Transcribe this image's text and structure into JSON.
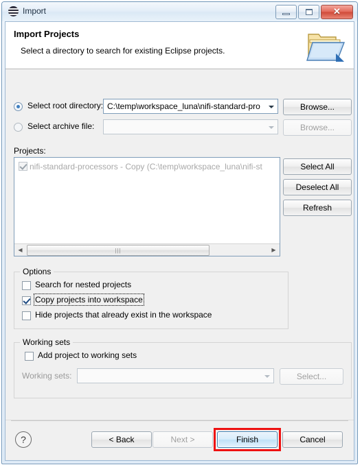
{
  "window": {
    "title": "Import",
    "icon": "eclipse-icon",
    "controls": {
      "minimize": "minimize-button",
      "maximize": "maximize-button",
      "close": "close-button",
      "close_glyph": "✕"
    }
  },
  "banner": {
    "title": "Import Projects",
    "subtitle": "Select a directory to search for existing Eclipse projects.",
    "icon": "import-folder-icon"
  },
  "source": {
    "root_directory": {
      "label": "Select root directory:",
      "mnemonic": "o",
      "selected": true,
      "value": "C:\\temp\\workspace_luna\\nifi-standard-pro",
      "browse_label": "Browse...",
      "browse_enabled": true
    },
    "archive_file": {
      "label": "Select archive file:",
      "mnemonic": "a",
      "selected": false,
      "value": "",
      "placeholder": "",
      "browse_label": "Browse...",
      "browse_enabled": false
    }
  },
  "projects": {
    "label": "Projects:",
    "items": [
      {
        "label": "nifi-standard-processors - Copy (C:\\temp\\workspace_luna\\nifi-st",
        "checked": true,
        "enabled": false
      }
    ],
    "buttons": {
      "select_all": "Select All",
      "deselect_all": "Deselect All",
      "refresh": "Refresh"
    },
    "scrollbar": {
      "left_arrow": "◀",
      "right_arrow": "▶",
      "thumb_grip": "|||"
    }
  },
  "options": {
    "title": "Options",
    "items": [
      {
        "label": "Search for nested projects",
        "checked": false,
        "focused": false
      },
      {
        "label": "Copy projects into workspace",
        "checked": true,
        "focused": true
      },
      {
        "label": "Hide projects that already exist in the workspace",
        "checked": false,
        "focused": false
      }
    ]
  },
  "working_sets": {
    "title": "Working sets",
    "add_checkbox": {
      "label": "Add project to working sets",
      "checked": false
    },
    "field_label": "Working sets:",
    "field_value": "",
    "field_enabled": false,
    "select_button": {
      "label": "Select...",
      "enabled": false
    }
  },
  "footer": {
    "help": "?",
    "back": {
      "label": "< Back",
      "enabled": true
    },
    "next": {
      "label": "Next >",
      "enabled": false
    },
    "finish": {
      "label": "Finish",
      "enabled": true,
      "focused": true,
      "annotated": true
    },
    "cancel": {
      "label": "Cancel",
      "enabled": true
    }
  },
  "colors": {
    "annotation": "#ee1111",
    "focus_blue": "#3c7fb1",
    "title_border": "#6f95b8",
    "field_border": "#7f9db9"
  }
}
